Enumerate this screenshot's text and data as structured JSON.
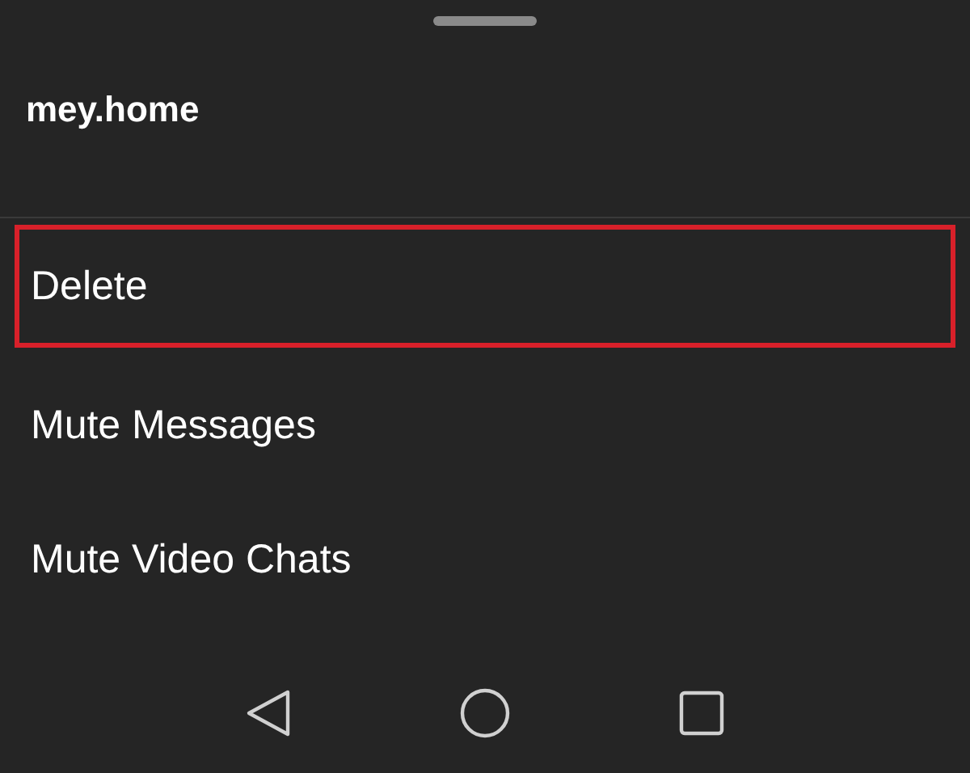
{
  "sheet": {
    "title": "mey.home",
    "items": [
      {
        "label": "Delete",
        "highlighted": true
      },
      {
        "label": "Mute Messages",
        "highlighted": false
      },
      {
        "label": "Mute Video Chats",
        "highlighted": false
      }
    ]
  }
}
